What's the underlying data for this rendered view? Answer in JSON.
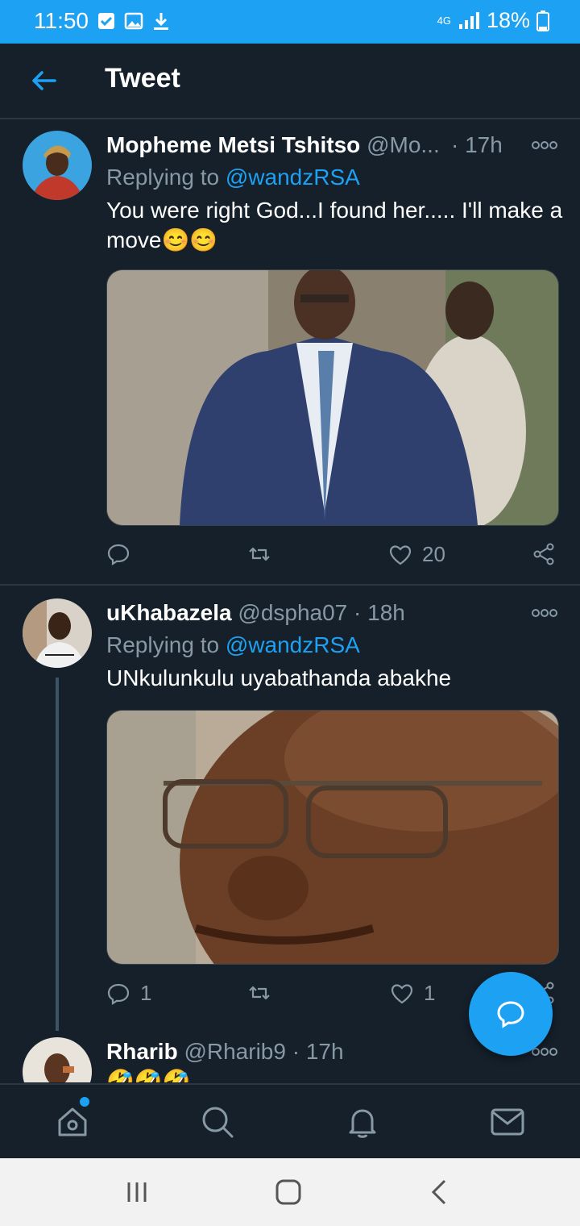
{
  "status_bar": {
    "time": "11:50",
    "network": "4G",
    "battery": "18%"
  },
  "app_bar": {
    "title": "Tweet",
    "back_icon": "arrow-left-icon"
  },
  "tweets": [
    {
      "name": "Mopheme Metsi Tshitso",
      "handle": "@Mo...",
      "time": "· 17h",
      "replying_prefix": "Replying to ",
      "replying_to": "@wandzRSA",
      "text": "You were  right God...I found her..... I'll make a move😊😊",
      "media_label": "photo",
      "actions": {
        "replies": "",
        "retweets": "",
        "likes": "20"
      }
    },
    {
      "name": "uKhabazela",
      "handle": "@dspha07",
      "time": "· 18h",
      "replying_prefix": "Replying to ",
      "replying_to": "@wandzRSA",
      "text": "UNkulunkulu uyabathanda abakhe",
      "media_label": "photo",
      "actions": {
        "replies": "1",
        "retweets": "",
        "likes": "1"
      }
    },
    {
      "name": "Rharib",
      "handle": "@Rharib9",
      "time": "· 17h",
      "text": "🤣🤣🤣"
    }
  ],
  "fab": {
    "icon": "compose-reply-icon"
  },
  "bottom_nav": [
    "home-icon",
    "search-icon",
    "notifications-icon",
    "messages-icon"
  ],
  "colors": {
    "accent": "#1da1f2",
    "background": "#15202b",
    "muted": "#8899a6",
    "divider": "#2b3742"
  }
}
